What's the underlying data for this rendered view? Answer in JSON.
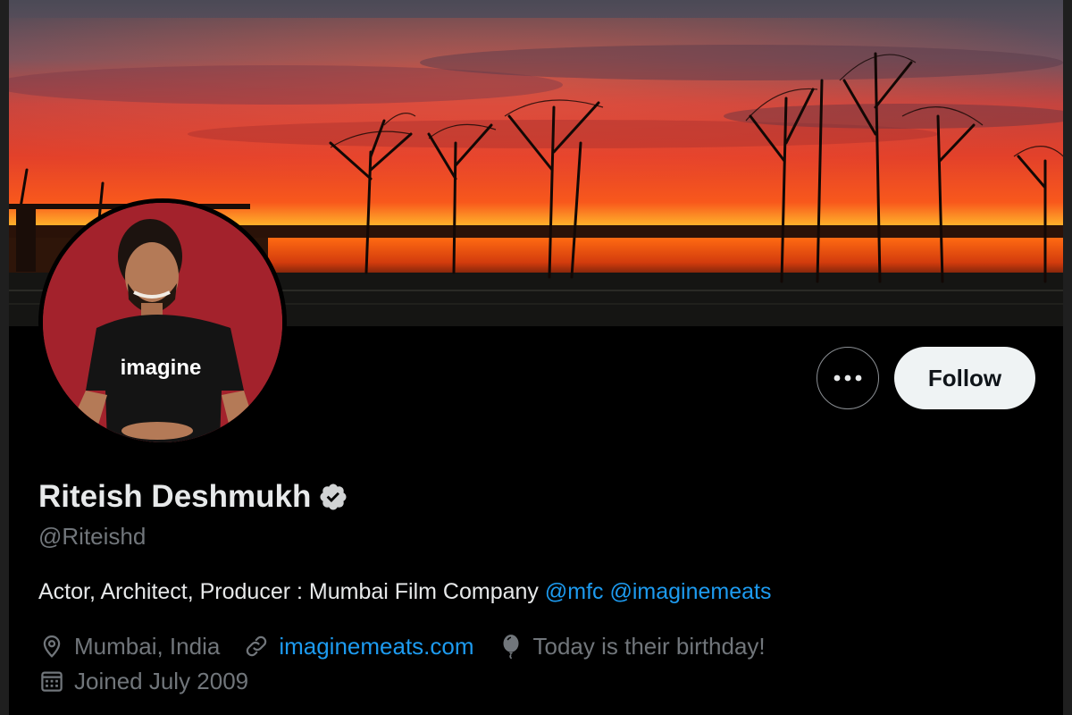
{
  "profile": {
    "display_name": "Riteish Deshmukh",
    "handle": "@Riteishd",
    "bio": {
      "text": "Actor, Architect, Producer : Mumbai Film Company",
      "mentions": [
        "@mfc",
        "@imaginemeats"
      ]
    },
    "location": "Mumbai, India",
    "website": "imaginemeats.com",
    "birthday": "Today is their birthday!",
    "joined": "Joined July 2009"
  },
  "avatar": {
    "shirt_text": "imagine"
  },
  "actions": {
    "more_icon": "more-horizontal-icon",
    "follow_label": "Follow"
  },
  "icons": {
    "verified": "verified-badge-icon",
    "location": "location-pin-icon",
    "website": "link-icon",
    "birthday": "balloon-icon",
    "joined": "calendar-icon"
  },
  "colors": {
    "background": "#000000",
    "primary_text": "#e7e9ea",
    "secondary_text": "#71767b",
    "link": "#1d9bf0",
    "follow_button_bg": "#eff3f4",
    "follow_button_text": "#0f1419",
    "avatar_bg": "#a3222c"
  }
}
